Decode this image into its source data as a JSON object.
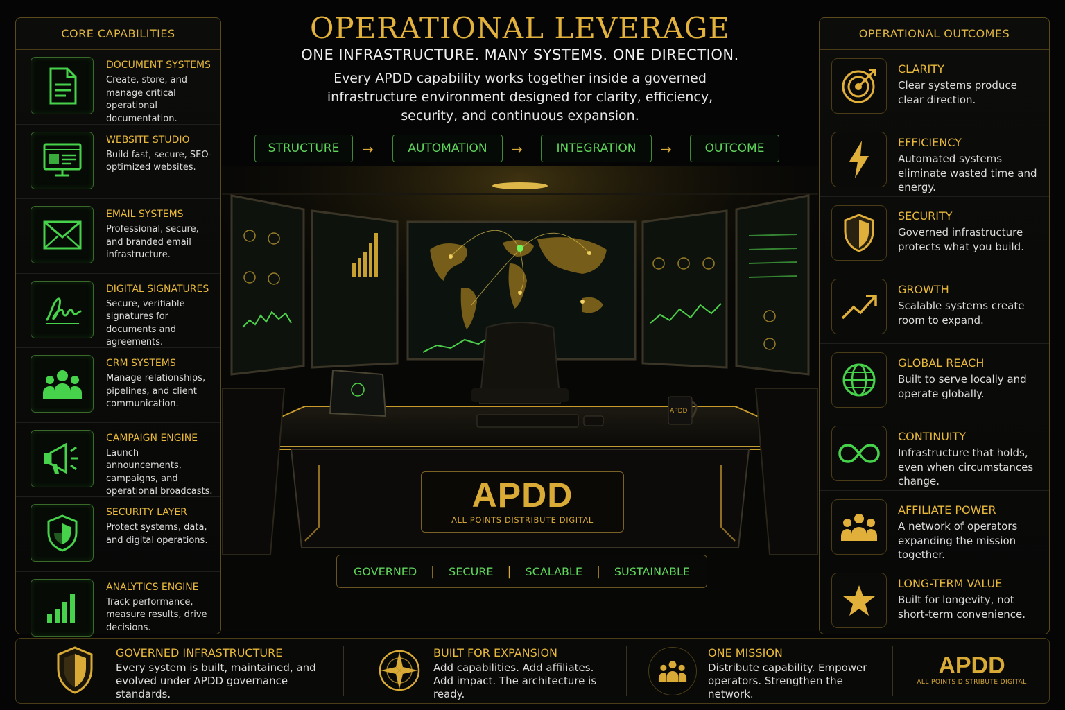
{
  "header": {
    "title": "OPERATIONAL LEVERAGE",
    "tagline": "ONE INFRASTRUCTURE. MANY SYSTEMS. ONE DIRECTION.",
    "intro": "Every APDD capability works together inside a governed infrastructure environment designed for clarity, efficiency, security, and continuous expansion."
  },
  "flow": {
    "steps": [
      "STRUCTURE",
      "AUTOMATION",
      "INTEGRATION",
      "OUTCOME"
    ],
    "arrow": "→"
  },
  "left_panel": {
    "title": "CORE CAPABILITIES",
    "items": [
      {
        "title": "DOCUMENT SYSTEMS",
        "desc": "Create, store, and manage critical operational documentation.",
        "icon": "document-icon"
      },
      {
        "title": "WEBSITE STUDIO",
        "desc": "Build fast, secure, SEO-optimized websites.",
        "icon": "monitor-icon"
      },
      {
        "title": "EMAIL SYSTEMS",
        "desc": "Professional, secure, and branded email infrastructure.",
        "icon": "envelope-icon"
      },
      {
        "title": "DIGITAL SIGNATURES",
        "desc": "Secure, verifiable signatures for documents and agreements.",
        "icon": "signature-icon"
      },
      {
        "title": "CRM SYSTEMS",
        "desc": "Manage relationships, pipelines, and client communication.",
        "icon": "users-icon"
      },
      {
        "title": "CAMPAIGN ENGINE",
        "desc": "Launch announcements, campaigns, and operational broadcasts.",
        "icon": "megaphone-icon"
      },
      {
        "title": "SECURITY LAYER",
        "desc": "Protect systems, data, and digital operations.",
        "icon": "shield-icon"
      },
      {
        "title": "ANALYTICS ENGINE",
        "desc": "Track performance, measure results, drive decisions.",
        "icon": "bar-chart-icon"
      }
    ]
  },
  "right_panel": {
    "title": "OPERATIONAL OUTCOMES",
    "items": [
      {
        "title": "CLARITY",
        "desc": "Clear systems produce clear direction.",
        "icon": "target-icon"
      },
      {
        "title": "EFFICIENCY",
        "desc": "Automated systems eliminate wasted time and energy.",
        "icon": "lightning-icon"
      },
      {
        "title": "SECURITY",
        "desc": "Governed infrastructure protects what you build.",
        "icon": "shield-icon"
      },
      {
        "title": "GROWTH",
        "desc": "Scalable systems create room to expand.",
        "icon": "trend-up-icon"
      },
      {
        "title": "GLOBAL REACH",
        "desc": "Built to serve locally and operate globally.",
        "icon": "globe-icon"
      },
      {
        "title": "CONTINUITY",
        "desc": "Infrastructure that holds, even when circumstances change.",
        "icon": "infinity-icon"
      },
      {
        "title": "AFFILIATE POWER",
        "desc": "A network of operators expanding the mission together.",
        "icon": "group-icon"
      },
      {
        "title": "LONG-TERM VALUE",
        "desc": "Built for longevity, not short-term convenience.",
        "icon": "star-icon"
      }
    ]
  },
  "center": {
    "brand": "APDD",
    "brand_sub": "ALL POINTS DISTRIBUTE DIGITAL",
    "mug_label": "APDD",
    "values": [
      "GOVERNED",
      "SECURE",
      "SCALABLE",
      "SUSTAINABLE"
    ],
    "separator": "|"
  },
  "bottom": {
    "items": [
      {
        "title": "GOVERNED INFRASTRUCTURE",
        "desc": "Every system is built, maintained, and evolved under APDD governance standards.",
        "icon": "shield-icon"
      },
      {
        "title": "BUILT FOR EXPANSION",
        "desc": "Add capabilities. Add affiliates. Add impact. The architecture is ready.",
        "icon": "compass-icon"
      },
      {
        "title": "ONE MISSION",
        "desc": "Distribute capability. Empower operators. Strengthen the network.",
        "icon": "group-icon"
      }
    ],
    "logo": "APDD",
    "logo_sub": "ALL POINTS DISTRIBUTE DIGITAL"
  },
  "colors": {
    "gold": "#e3b23c",
    "green": "#5ed65a",
    "background": "#050505"
  }
}
